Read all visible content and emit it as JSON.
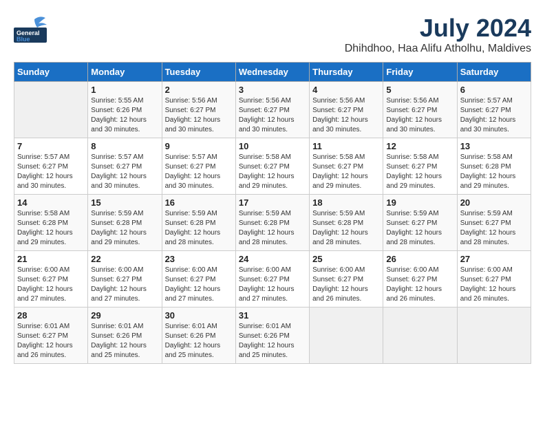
{
  "header": {
    "logo_general": "General",
    "logo_blue": "Blue",
    "month_title": "July 2024",
    "location": "Dhihdhoo, Haa Alifu Atholhu, Maldives"
  },
  "days_of_week": [
    "Sunday",
    "Monday",
    "Tuesday",
    "Wednesday",
    "Thursday",
    "Friday",
    "Saturday"
  ],
  "weeks": [
    [
      {
        "day": "",
        "info": ""
      },
      {
        "day": "1",
        "info": "Sunrise: 5:55 AM\nSunset: 6:26 PM\nDaylight: 12 hours\nand 30 minutes."
      },
      {
        "day": "2",
        "info": "Sunrise: 5:56 AM\nSunset: 6:27 PM\nDaylight: 12 hours\nand 30 minutes."
      },
      {
        "day": "3",
        "info": "Sunrise: 5:56 AM\nSunset: 6:27 PM\nDaylight: 12 hours\nand 30 minutes."
      },
      {
        "day": "4",
        "info": "Sunrise: 5:56 AM\nSunset: 6:27 PM\nDaylight: 12 hours\nand 30 minutes."
      },
      {
        "day": "5",
        "info": "Sunrise: 5:56 AM\nSunset: 6:27 PM\nDaylight: 12 hours\nand 30 minutes."
      },
      {
        "day": "6",
        "info": "Sunrise: 5:57 AM\nSunset: 6:27 PM\nDaylight: 12 hours\nand 30 minutes."
      }
    ],
    [
      {
        "day": "7",
        "info": "Sunrise: 5:57 AM\nSunset: 6:27 PM\nDaylight: 12 hours\nand 30 minutes."
      },
      {
        "day": "8",
        "info": "Sunrise: 5:57 AM\nSunset: 6:27 PM\nDaylight: 12 hours\nand 30 minutes."
      },
      {
        "day": "9",
        "info": "Sunrise: 5:57 AM\nSunset: 6:27 PM\nDaylight: 12 hours\nand 30 minutes."
      },
      {
        "day": "10",
        "info": "Sunrise: 5:58 AM\nSunset: 6:27 PM\nDaylight: 12 hours\nand 29 minutes."
      },
      {
        "day": "11",
        "info": "Sunrise: 5:58 AM\nSunset: 6:27 PM\nDaylight: 12 hours\nand 29 minutes."
      },
      {
        "day": "12",
        "info": "Sunrise: 5:58 AM\nSunset: 6:27 PM\nDaylight: 12 hours\nand 29 minutes."
      },
      {
        "day": "13",
        "info": "Sunrise: 5:58 AM\nSunset: 6:28 PM\nDaylight: 12 hours\nand 29 minutes."
      }
    ],
    [
      {
        "day": "14",
        "info": "Sunrise: 5:58 AM\nSunset: 6:28 PM\nDaylight: 12 hours\nand 29 minutes."
      },
      {
        "day": "15",
        "info": "Sunrise: 5:59 AM\nSunset: 6:28 PM\nDaylight: 12 hours\nand 29 minutes."
      },
      {
        "day": "16",
        "info": "Sunrise: 5:59 AM\nSunset: 6:28 PM\nDaylight: 12 hours\nand 28 minutes."
      },
      {
        "day": "17",
        "info": "Sunrise: 5:59 AM\nSunset: 6:28 PM\nDaylight: 12 hours\nand 28 minutes."
      },
      {
        "day": "18",
        "info": "Sunrise: 5:59 AM\nSunset: 6:28 PM\nDaylight: 12 hours\nand 28 minutes."
      },
      {
        "day": "19",
        "info": "Sunrise: 5:59 AM\nSunset: 6:27 PM\nDaylight: 12 hours\nand 28 minutes."
      },
      {
        "day": "20",
        "info": "Sunrise: 5:59 AM\nSunset: 6:27 PM\nDaylight: 12 hours\nand 28 minutes."
      }
    ],
    [
      {
        "day": "21",
        "info": "Sunrise: 6:00 AM\nSunset: 6:27 PM\nDaylight: 12 hours\nand 27 minutes."
      },
      {
        "day": "22",
        "info": "Sunrise: 6:00 AM\nSunset: 6:27 PM\nDaylight: 12 hours\nand 27 minutes."
      },
      {
        "day": "23",
        "info": "Sunrise: 6:00 AM\nSunset: 6:27 PM\nDaylight: 12 hours\nand 27 minutes."
      },
      {
        "day": "24",
        "info": "Sunrise: 6:00 AM\nSunset: 6:27 PM\nDaylight: 12 hours\nand 27 minutes."
      },
      {
        "day": "25",
        "info": "Sunrise: 6:00 AM\nSunset: 6:27 PM\nDaylight: 12 hours\nand 26 minutes."
      },
      {
        "day": "26",
        "info": "Sunrise: 6:00 AM\nSunset: 6:27 PM\nDaylight: 12 hours\nand 26 minutes."
      },
      {
        "day": "27",
        "info": "Sunrise: 6:00 AM\nSunset: 6:27 PM\nDaylight: 12 hours\nand 26 minutes."
      }
    ],
    [
      {
        "day": "28",
        "info": "Sunrise: 6:01 AM\nSunset: 6:27 PM\nDaylight: 12 hours\nand 26 minutes."
      },
      {
        "day": "29",
        "info": "Sunrise: 6:01 AM\nSunset: 6:26 PM\nDaylight: 12 hours\nand 25 minutes."
      },
      {
        "day": "30",
        "info": "Sunrise: 6:01 AM\nSunset: 6:26 PM\nDaylight: 12 hours\nand 25 minutes."
      },
      {
        "day": "31",
        "info": "Sunrise: 6:01 AM\nSunset: 6:26 PM\nDaylight: 12 hours\nand 25 minutes."
      },
      {
        "day": "",
        "info": ""
      },
      {
        "day": "",
        "info": ""
      },
      {
        "day": "",
        "info": ""
      }
    ]
  ]
}
